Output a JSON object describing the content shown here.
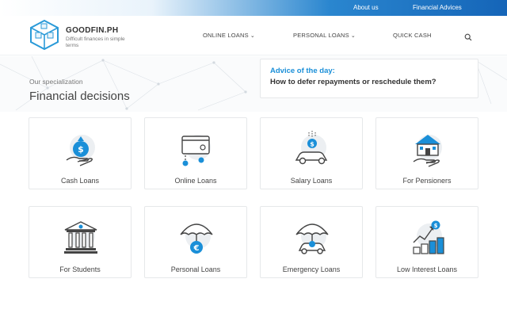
{
  "topbar": {
    "about": "About us",
    "advices": "Financial Advices"
  },
  "brand": {
    "name": "GOODFIN.PH",
    "tagline": "Difficult finances in simple terms"
  },
  "nav": [
    {
      "label": "ONLINE LOANS",
      "has_dropdown": true
    },
    {
      "label": "PERSONAL LOANS",
      "has_dropdown": true
    },
    {
      "label": "QUICK CASH",
      "has_dropdown": false
    }
  ],
  "specialization": {
    "label": "Our specialization",
    "title": "Financial decisions"
  },
  "advice": {
    "heading": "Advice of the day:",
    "question": "How to defer repayments or reschedule them?"
  },
  "categories": [
    {
      "label": "Cash Loans",
      "icon": "money-bag-hand-icon"
    },
    {
      "label": "Online Loans",
      "icon": "credit-card-icon"
    },
    {
      "label": "Salary Loans",
      "icon": "car-money-icon"
    },
    {
      "label": "For Pensioners",
      "icon": "house-hand-icon"
    },
    {
      "label": "For Students",
      "icon": "bank-building-icon"
    },
    {
      "label": "Personal Loans",
      "icon": "umbrella-euro-icon"
    },
    {
      "label": "Emergency Loans",
      "icon": "umbrella-car-icon"
    },
    {
      "label": "Low Interest Loans",
      "icon": "growth-coins-icon"
    }
  ],
  "colors": {
    "accent": "#1a8fd8",
    "topbar_dark": "#1565b8"
  }
}
